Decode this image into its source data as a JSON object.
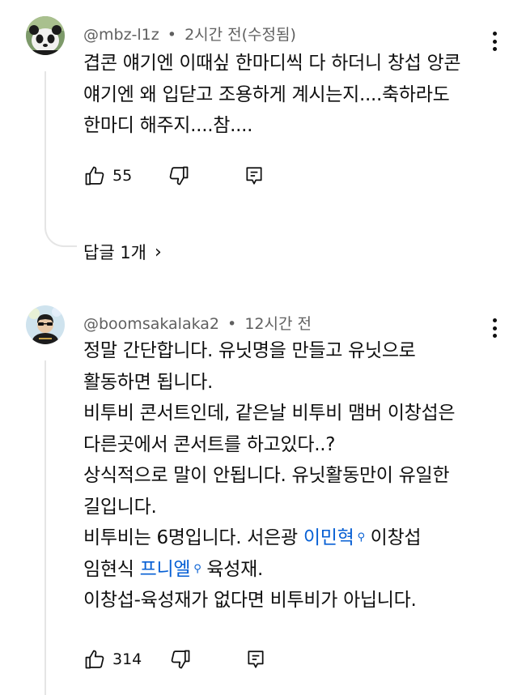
{
  "comments": [
    {
      "author": "@mbz-l1z",
      "separator": "•",
      "time": "2시간 전(수정됨)",
      "lines": [
        "겹콘 얘기엔 이때싶 한마디씩 다 하더니 창섭 앙콘",
        "얘기엔 왜 입닫고 조용하게 계시는지....축하라도",
        "한마디 해주지....참...."
      ],
      "likes": "55",
      "replies_label": "답글 1개",
      "avatar_icon": "panda-avatar"
    },
    {
      "author": "@boomsakalaka2",
      "separator": "•",
      "time": "12시간 전",
      "lines": [
        "정말 간단합니다. 유닛명을 만들고 유닛으로",
        "활동하면 됩니다.",
        "비투비 콘서트인데, 같은날 비투비 맴버 이창섭은",
        "다른곳에서 콘서트를 하고있다..?",
        "상식적으로 말이 안됩니다. 유닛활동만이 유일한",
        "길입니다."
      ],
      "line7_prefix": "비투비는 6명입니다. 서은광 ",
      "line7_link": "이민혁",
      "line7_suffix": " 이창섭",
      "line8_prefix": "임현식 ",
      "line8_link": "프니엘",
      "line8_suffix": " 육성재.",
      "line9": "이창섭-육성재가 없다면 비투비가 아닙니다.",
      "likes": "314",
      "avatar_icon": "person-sunglasses-avatar"
    }
  ],
  "icons": {
    "like": "thumbs-up-icon",
    "dislike": "thumbs-down-icon",
    "reply": "reply-icon",
    "more": "more-vert-icon",
    "search_small": "search-icon",
    "chevron": "chevron-right-icon"
  },
  "colors": {
    "text": "#0f0f0f",
    "meta": "#606060",
    "link": "#065fd4",
    "thread": "#e5e5e5"
  }
}
